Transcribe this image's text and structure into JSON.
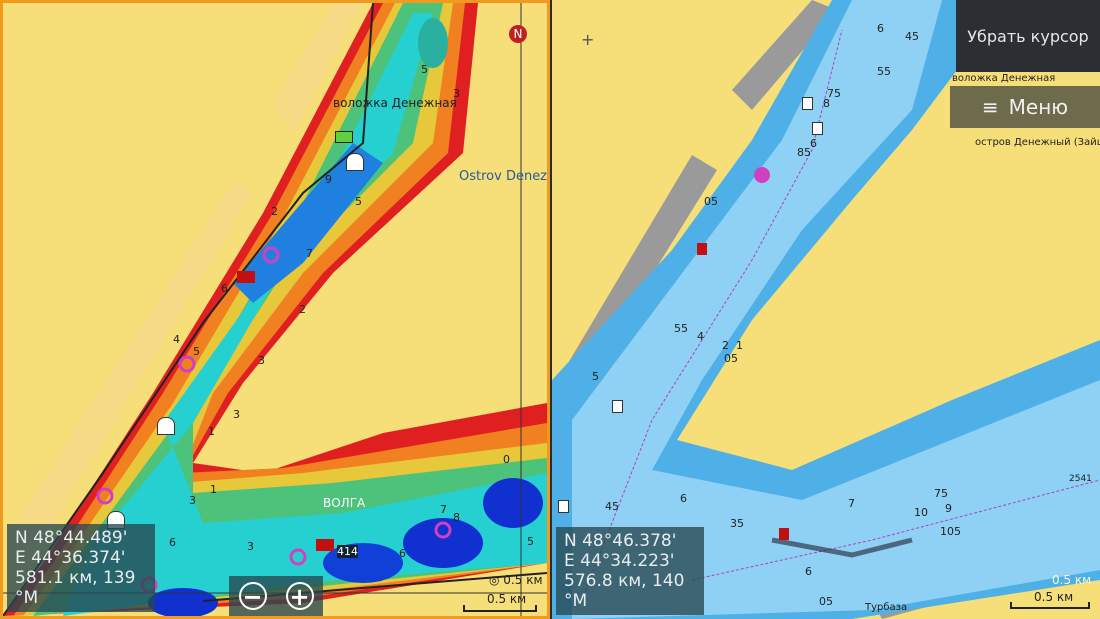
{
  "left_pane": {
    "labels": {
      "channel": "воложка Денежная",
      "island": "Ostrov Denez",
      "river": "ВОЛГА",
      "waypoint": "414"
    },
    "depths": [
      "5",
      "3",
      "9",
      "7",
      "5",
      "6",
      "2",
      "3",
      "4",
      "5",
      "3",
      "1",
      "1",
      "0",
      "6",
      "3",
      "8",
      "7",
      "5",
      "6",
      "3",
      "2"
    ],
    "coords": {
      "lat": "N  48°44.489'",
      "lon": "E  44°36.374'",
      "range": "581.1 км, 139 °M"
    },
    "zoom_out": "−",
    "zoom_in": "+",
    "range_ring": "0.5 км",
    "scale": "0.5 км",
    "north": "N"
  },
  "right_pane": {
    "buttons": {
      "remove_cursor": "Убрать курсор",
      "menu": "Меню",
      "menu_icon": "≡"
    },
    "labels": {
      "channel": "воложка Денежная",
      "island": "остров Денежный (Зайце",
      "base": "Турбаза",
      "track": "2541"
    },
    "depths": [
      "6",
      "45",
      "55",
      "75",
      "8",
      "85",
      "6",
      "05",
      "4",
      "55",
      "2",
      "1",
      "05",
      "5",
      "45",
      "35",
      "6",
      "7",
      "75",
      "9",
      "10",
      "105",
      "6",
      "05"
    ],
    "coords": {
      "lat": "N  48°46.378'",
      "lon": "E  44°34.223'",
      "range": "576.8 км, 140 °M"
    },
    "range_ring": "0.5 км",
    "scale": "0.5 км"
  },
  "colors": {
    "land": "#f6df78",
    "border": "#f29a1e",
    "water_light": "#8fd0f5",
    "water": "#4fb0e8"
  }
}
